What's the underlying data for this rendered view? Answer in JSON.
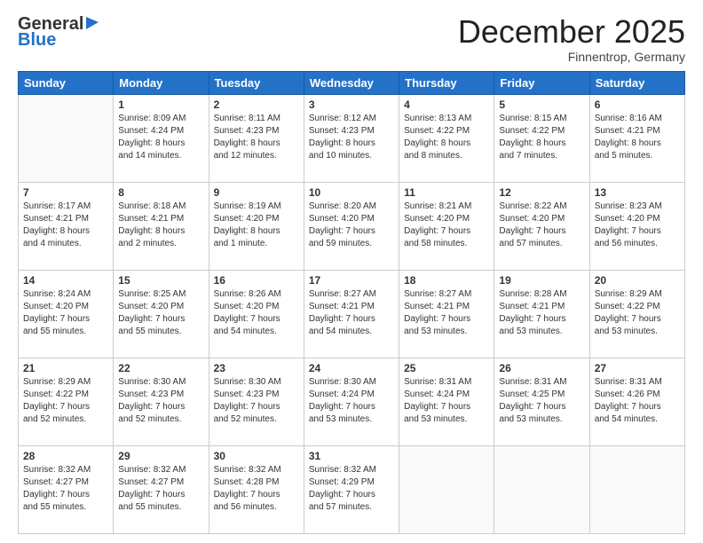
{
  "header": {
    "logo_general": "General",
    "logo_blue": "Blue",
    "month": "December 2025",
    "location": "Finnentrop, Germany"
  },
  "weekdays": [
    "Sunday",
    "Monday",
    "Tuesday",
    "Wednesday",
    "Thursday",
    "Friday",
    "Saturday"
  ],
  "weeks": [
    [
      {
        "day": "",
        "info": ""
      },
      {
        "day": "1",
        "info": "Sunrise: 8:09 AM\nSunset: 4:24 PM\nDaylight: 8 hours\nand 14 minutes."
      },
      {
        "day": "2",
        "info": "Sunrise: 8:11 AM\nSunset: 4:23 PM\nDaylight: 8 hours\nand 12 minutes."
      },
      {
        "day": "3",
        "info": "Sunrise: 8:12 AM\nSunset: 4:23 PM\nDaylight: 8 hours\nand 10 minutes."
      },
      {
        "day": "4",
        "info": "Sunrise: 8:13 AM\nSunset: 4:22 PM\nDaylight: 8 hours\nand 8 minutes."
      },
      {
        "day": "5",
        "info": "Sunrise: 8:15 AM\nSunset: 4:22 PM\nDaylight: 8 hours\nand 7 minutes."
      },
      {
        "day": "6",
        "info": "Sunrise: 8:16 AM\nSunset: 4:21 PM\nDaylight: 8 hours\nand 5 minutes."
      }
    ],
    [
      {
        "day": "7",
        "info": "Sunrise: 8:17 AM\nSunset: 4:21 PM\nDaylight: 8 hours\nand 4 minutes."
      },
      {
        "day": "8",
        "info": "Sunrise: 8:18 AM\nSunset: 4:21 PM\nDaylight: 8 hours\nand 2 minutes."
      },
      {
        "day": "9",
        "info": "Sunrise: 8:19 AM\nSunset: 4:20 PM\nDaylight: 8 hours\nand 1 minute."
      },
      {
        "day": "10",
        "info": "Sunrise: 8:20 AM\nSunset: 4:20 PM\nDaylight: 7 hours\nand 59 minutes."
      },
      {
        "day": "11",
        "info": "Sunrise: 8:21 AM\nSunset: 4:20 PM\nDaylight: 7 hours\nand 58 minutes."
      },
      {
        "day": "12",
        "info": "Sunrise: 8:22 AM\nSunset: 4:20 PM\nDaylight: 7 hours\nand 57 minutes."
      },
      {
        "day": "13",
        "info": "Sunrise: 8:23 AM\nSunset: 4:20 PM\nDaylight: 7 hours\nand 56 minutes."
      }
    ],
    [
      {
        "day": "14",
        "info": "Sunrise: 8:24 AM\nSunset: 4:20 PM\nDaylight: 7 hours\nand 55 minutes."
      },
      {
        "day": "15",
        "info": "Sunrise: 8:25 AM\nSunset: 4:20 PM\nDaylight: 7 hours\nand 55 minutes."
      },
      {
        "day": "16",
        "info": "Sunrise: 8:26 AM\nSunset: 4:20 PM\nDaylight: 7 hours\nand 54 minutes."
      },
      {
        "day": "17",
        "info": "Sunrise: 8:27 AM\nSunset: 4:21 PM\nDaylight: 7 hours\nand 54 minutes."
      },
      {
        "day": "18",
        "info": "Sunrise: 8:27 AM\nSunset: 4:21 PM\nDaylight: 7 hours\nand 53 minutes."
      },
      {
        "day": "19",
        "info": "Sunrise: 8:28 AM\nSunset: 4:21 PM\nDaylight: 7 hours\nand 53 minutes."
      },
      {
        "day": "20",
        "info": "Sunrise: 8:29 AM\nSunset: 4:22 PM\nDaylight: 7 hours\nand 53 minutes."
      }
    ],
    [
      {
        "day": "21",
        "info": "Sunrise: 8:29 AM\nSunset: 4:22 PM\nDaylight: 7 hours\nand 52 minutes."
      },
      {
        "day": "22",
        "info": "Sunrise: 8:30 AM\nSunset: 4:23 PM\nDaylight: 7 hours\nand 52 minutes."
      },
      {
        "day": "23",
        "info": "Sunrise: 8:30 AM\nSunset: 4:23 PM\nDaylight: 7 hours\nand 52 minutes."
      },
      {
        "day": "24",
        "info": "Sunrise: 8:30 AM\nSunset: 4:24 PM\nDaylight: 7 hours\nand 53 minutes."
      },
      {
        "day": "25",
        "info": "Sunrise: 8:31 AM\nSunset: 4:24 PM\nDaylight: 7 hours\nand 53 minutes."
      },
      {
        "day": "26",
        "info": "Sunrise: 8:31 AM\nSunset: 4:25 PM\nDaylight: 7 hours\nand 53 minutes."
      },
      {
        "day": "27",
        "info": "Sunrise: 8:31 AM\nSunset: 4:26 PM\nDaylight: 7 hours\nand 54 minutes."
      }
    ],
    [
      {
        "day": "28",
        "info": "Sunrise: 8:32 AM\nSunset: 4:27 PM\nDaylight: 7 hours\nand 55 minutes."
      },
      {
        "day": "29",
        "info": "Sunrise: 8:32 AM\nSunset: 4:27 PM\nDaylight: 7 hours\nand 55 minutes."
      },
      {
        "day": "30",
        "info": "Sunrise: 8:32 AM\nSunset: 4:28 PM\nDaylight: 7 hours\nand 56 minutes."
      },
      {
        "day": "31",
        "info": "Sunrise: 8:32 AM\nSunset: 4:29 PM\nDaylight: 7 hours\nand 57 minutes."
      },
      {
        "day": "",
        "info": ""
      },
      {
        "day": "",
        "info": ""
      },
      {
        "day": "",
        "info": ""
      }
    ]
  ]
}
